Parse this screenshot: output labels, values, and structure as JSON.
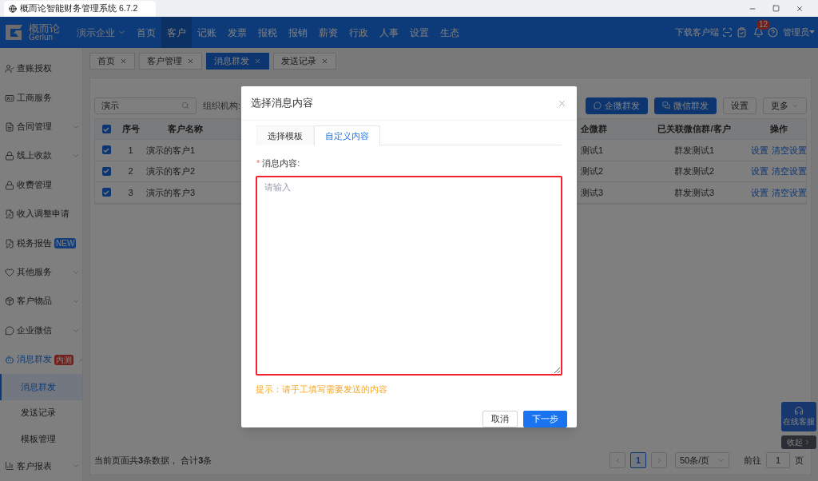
{
  "browser": {
    "title": "概而论智能财务管理系统 6.7.2"
  },
  "nav": {
    "logo": {
      "name": "概而论",
      "subtitle": "Gerlun"
    },
    "company": "演示企业",
    "items": [
      {
        "label": "首页",
        "selected": false
      },
      {
        "label": "客户",
        "selected": true
      },
      {
        "label": "记账",
        "selected": false
      },
      {
        "label": "发票",
        "selected": false
      },
      {
        "label": "报税",
        "selected": false
      },
      {
        "label": "报销",
        "selected": false
      },
      {
        "label": "薪资",
        "selected": false
      },
      {
        "label": "行政",
        "selected": false
      },
      {
        "label": "人事",
        "selected": false
      },
      {
        "label": "设置",
        "selected": false
      },
      {
        "label": "生态",
        "selected": false
      }
    ],
    "download": "下载客户端",
    "notification_count": "12",
    "user": "管理员"
  },
  "sidebar": {
    "items": [
      {
        "label": "查账授权"
      },
      {
        "label": "工商服务"
      },
      {
        "label": "合同管理",
        "expanded": false
      },
      {
        "label": "线上收款",
        "expanded": false
      },
      {
        "label": "收费管理"
      },
      {
        "label": "收入调整申请"
      },
      {
        "label": "税务报告",
        "badge": {
          "text": "NEW",
          "kind": "new"
        }
      },
      {
        "label": "其他服务",
        "expanded": false
      },
      {
        "label": "客户物品",
        "expanded": false
      },
      {
        "label": "企业微信",
        "expanded": false
      },
      {
        "label": "消息群发",
        "expanded": true,
        "badge": {
          "text": "内测",
          "kind": "beta"
        },
        "children": [
          {
            "label": "消息群发",
            "selected": true
          },
          {
            "label": "发送记录",
            "selected": false
          },
          {
            "label": "模板管理",
            "selected": false
          }
        ]
      },
      {
        "label": "客户报表",
        "expanded": false
      }
    ]
  },
  "page_tabs": [
    {
      "label": "首页",
      "selected": false
    },
    {
      "label": "客户管理",
      "selected": false
    },
    {
      "label": "消息群发",
      "selected": true
    },
    {
      "label": "发送记录",
      "selected": false
    }
  ],
  "toolbar": {
    "search": {
      "value": "演示"
    },
    "org_label": "组织机构:",
    "buttons": [
      {
        "label": "企微群发",
        "kind": "wecom"
      },
      {
        "label": "微信群发",
        "kind": "wechat"
      },
      {
        "label": "设置",
        "kind": "default"
      },
      {
        "label": "更多",
        "kind": "dropdown"
      }
    ]
  },
  "table": {
    "header_checked": true,
    "columns": [
      "序号",
      "客户名称",
      "企微群",
      "已关联微信群/客户",
      "操作"
    ],
    "rows": [
      {
        "checked": true,
        "cells": [
          "1",
          "演示的客户1",
          "测试1",
          "群发测试1"
        ],
        "actions": [
          "设置",
          "清空设置"
        ]
      },
      {
        "checked": true,
        "cells": [
          "2",
          "演示的客户2",
          "测试2",
          "群发测试2"
        ],
        "actions": [
          "设置",
          "清空设置"
        ]
      },
      {
        "checked": true,
        "cells": [
          "3",
          "演示的客户3",
          "测试3",
          "群发测试3"
        ],
        "actions": [
          "设置",
          "清空设置"
        ]
      }
    ]
  },
  "footer": {
    "summary": "当前页面共**3**条数据， 合计**3**条",
    "pages": [
      {
        "label": "1",
        "selected": true
      }
    ],
    "page_size": "50条/页",
    "goto_label": "前往",
    "goto_value": "1",
    "page_unit": "页"
  },
  "support": {
    "label": "在线客服",
    "collapse": "收起"
  },
  "dialog": {
    "title": "选择消息内容",
    "tabs": [
      {
        "label": "选择模板",
        "selected": false
      },
      {
        "label": "自定义内容",
        "selected": true
      }
    ],
    "field": {
      "label": "消息内容:",
      "required_mark": "*",
      "placeholder": "请输入",
      "error": true
    },
    "hint": "提示：请手工填写需要发送的内容",
    "buttons": [
      {
        "label": "取消",
        "kind": "default"
      },
      {
        "label": "下一步",
        "kind": "primary"
      }
    ]
  }
}
